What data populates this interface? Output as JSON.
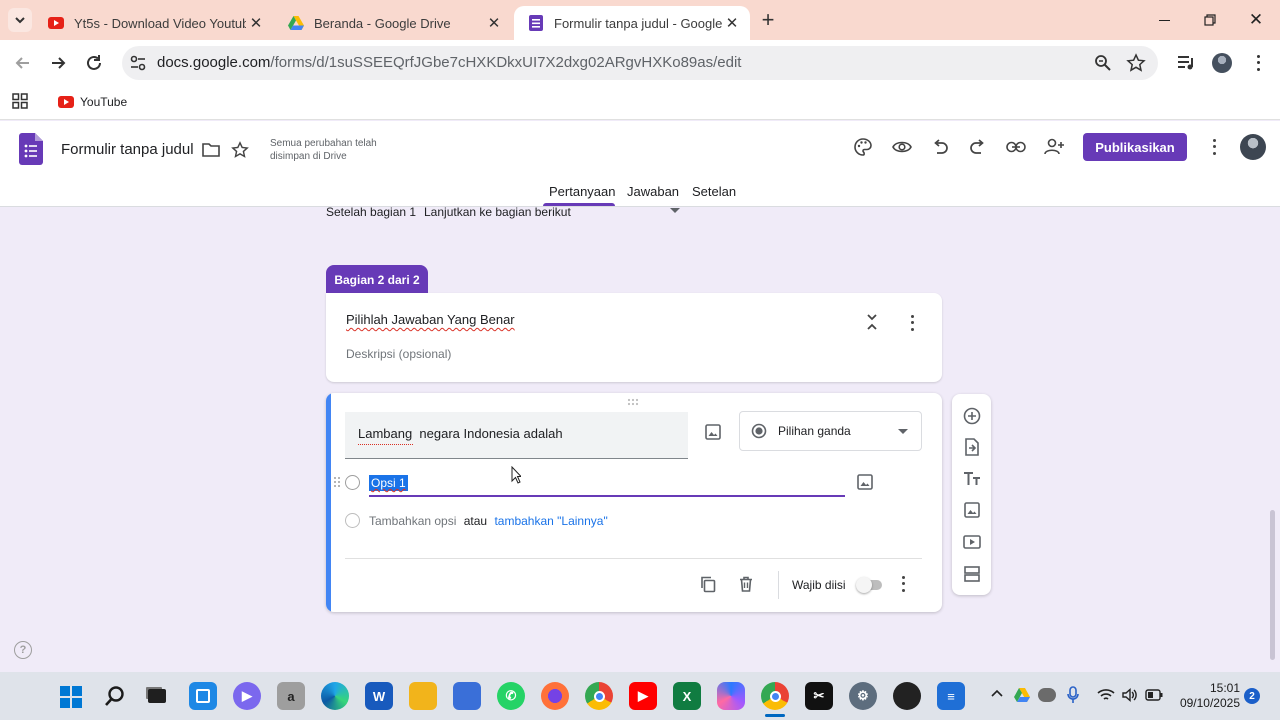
{
  "browser": {
    "tabs": [
      {
        "title": "Yt5s - Download Video Youtube",
        "icon": "youtube-favicon"
      },
      {
        "title": "Beranda - Google Drive",
        "icon": "drive-favicon"
      },
      {
        "title": "Formulir tanpa judul - Google F",
        "icon": "forms-favicon"
      }
    ],
    "url_host": "docs.google.com",
    "url_path": "/forms/d/1suSSEEQrfJGbe7cHXKDkxUI7X2dxg02ARgvHXKo89as/edit",
    "bookmarks": [
      {
        "label": "YouTube"
      }
    ]
  },
  "forms_header": {
    "title": "Formulir tanpa judul",
    "save_status_line1": "Semua perubahan telah",
    "save_status_line2": "disimpan di Drive",
    "publish_label": "Publikasikan",
    "tabs": [
      {
        "label": "Pertanyaan",
        "active": true
      },
      {
        "label": "Jawaban",
        "active": false
      },
      {
        "label": "Setelan",
        "active": false
      }
    ]
  },
  "section_nav": {
    "label": "Setelah bagian 1",
    "value": "Lanjutkan ke bagian berikut"
  },
  "section": {
    "badge": "Bagian 2 dari 2",
    "title": "Pilihlah Jawaban Yang Benar",
    "description_placeholder": "Deskripsi (opsional)"
  },
  "question": {
    "text": "Lambang  negara Indonesia adalah",
    "type": "Pilihan ganda",
    "options": [
      {
        "label": "Opsi 1"
      }
    ],
    "add_option": "Tambahkan opsi",
    "or": "atau",
    "add_other": "tambahkan \"Lainnya\"",
    "required_label": "Wajib diisi",
    "required": false
  },
  "taskbar": {
    "time": "15:01",
    "date": "09/10/2025",
    "notifications": "2"
  },
  "colors": {
    "accent": "#673ab7",
    "focus_blue": "#4285f4",
    "background": "#f0ebf8",
    "tab_strip": "#f9d9cf"
  }
}
